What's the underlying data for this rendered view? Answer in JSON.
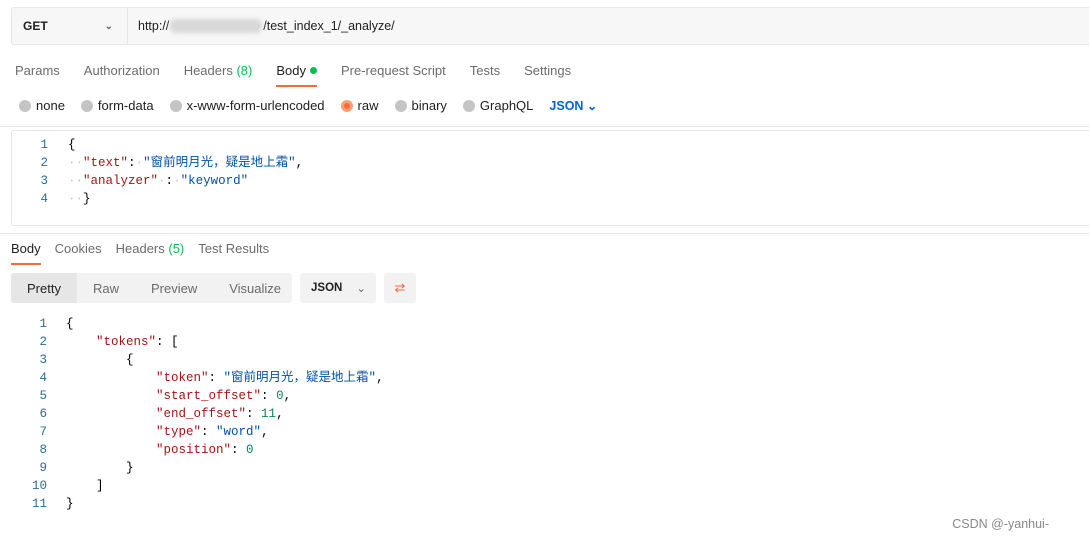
{
  "request": {
    "method": "GET",
    "url_prefix": "http://",
    "url_suffix": "/test_index_1/_analyze/"
  },
  "request_tabs": [
    {
      "label": "Params"
    },
    {
      "label": "Authorization"
    },
    {
      "label": "Headers",
      "count": "(8)"
    },
    {
      "label": "Body",
      "active": true,
      "indicator": "green-dot"
    },
    {
      "label": "Pre-request Script"
    },
    {
      "label": "Tests"
    },
    {
      "label": "Settings"
    }
  ],
  "body_types": [
    {
      "label": "none"
    },
    {
      "label": "form-data"
    },
    {
      "label": "x-www-form-urlencoded"
    },
    {
      "label": "raw",
      "selected": true
    },
    {
      "label": "binary"
    },
    {
      "label": "GraphQL"
    }
  ],
  "body_format": "JSON",
  "request_body": [
    {
      "n": "1",
      "segs": [
        [
          "p",
          "{"
        ]
      ]
    },
    {
      "n": "2",
      "segs": [
        [
          "ws",
          "··"
        ],
        [
          "k",
          "\"text\""
        ],
        [
          "p",
          ":"
        ],
        [
          "ws",
          "·"
        ],
        [
          "s",
          "\"窗前明月光，疑是地上霜\""
        ],
        [
          "p",
          ","
        ]
      ]
    },
    {
      "n": "3",
      "segs": [
        [
          "ws",
          "··"
        ],
        [
          "k",
          "\"analyzer\""
        ],
        [
          "ws",
          "·"
        ],
        [
          "p",
          ":"
        ],
        [
          "ws",
          "·"
        ],
        [
          "s",
          "\"keyword\""
        ]
      ]
    },
    {
      "n": "4",
      "segs": [
        [
          "ws",
          "··"
        ],
        [
          "p",
          "}"
        ]
      ]
    }
  ],
  "response_tabs": [
    {
      "label": "Body",
      "active": true
    },
    {
      "label": "Cookies"
    },
    {
      "label": "Headers",
      "count": "(5)"
    },
    {
      "label": "Test Results"
    }
  ],
  "view_modes": [
    "Pretty",
    "Raw",
    "Preview",
    "Visualize"
  ],
  "response_format": "JSON",
  "response_body": [
    {
      "n": "1",
      "segs": [
        [
          "p",
          "{"
        ]
      ]
    },
    {
      "n": "2",
      "segs": [
        [
          "p",
          "    "
        ],
        [
          "k",
          "\"tokens\""
        ],
        [
          "p",
          ": ["
        ]
      ]
    },
    {
      "n": "3",
      "segs": [
        [
          "p",
          "        {"
        ]
      ]
    },
    {
      "n": "4",
      "segs": [
        [
          "p",
          "            "
        ],
        [
          "k",
          "\"token\""
        ],
        [
          "p",
          ": "
        ],
        [
          "s",
          "\"窗前明月光，疑是地上霜\""
        ],
        [
          "p",
          ","
        ]
      ]
    },
    {
      "n": "5",
      "segs": [
        [
          "p",
          "            "
        ],
        [
          "k",
          "\"start_offset\""
        ],
        [
          "p",
          ": "
        ],
        [
          "n",
          "0"
        ],
        [
          "p",
          ","
        ]
      ]
    },
    {
      "n": "6",
      "segs": [
        [
          "p",
          "            "
        ],
        [
          "k",
          "\"end_offset\""
        ],
        [
          "p",
          ": "
        ],
        [
          "n",
          "11"
        ],
        [
          "p",
          ","
        ]
      ]
    },
    {
      "n": "7",
      "segs": [
        [
          "p",
          "            "
        ],
        [
          "k",
          "\"type\""
        ],
        [
          "p",
          ": "
        ],
        [
          "s",
          "\"word\""
        ],
        [
          "p",
          ","
        ]
      ]
    },
    {
      "n": "8",
      "segs": [
        [
          "p",
          "            "
        ],
        [
          "k",
          "\"position\""
        ],
        [
          "p",
          ": "
        ],
        [
          "n",
          "0"
        ]
      ]
    },
    {
      "n": "9",
      "segs": [
        [
          "p",
          "        }"
        ]
      ]
    },
    {
      "n": "10",
      "segs": [
        [
          "p",
          "    ]"
        ]
      ]
    },
    {
      "n": "11",
      "segs": [
        [
          "p",
          "}"
        ]
      ]
    }
  ],
  "watermark": "CSDN @-yanhui-",
  "colors": {
    "accent": "#f26b3a",
    "active_dot": "#0cbb52",
    "json_link": "#0265d2"
  }
}
